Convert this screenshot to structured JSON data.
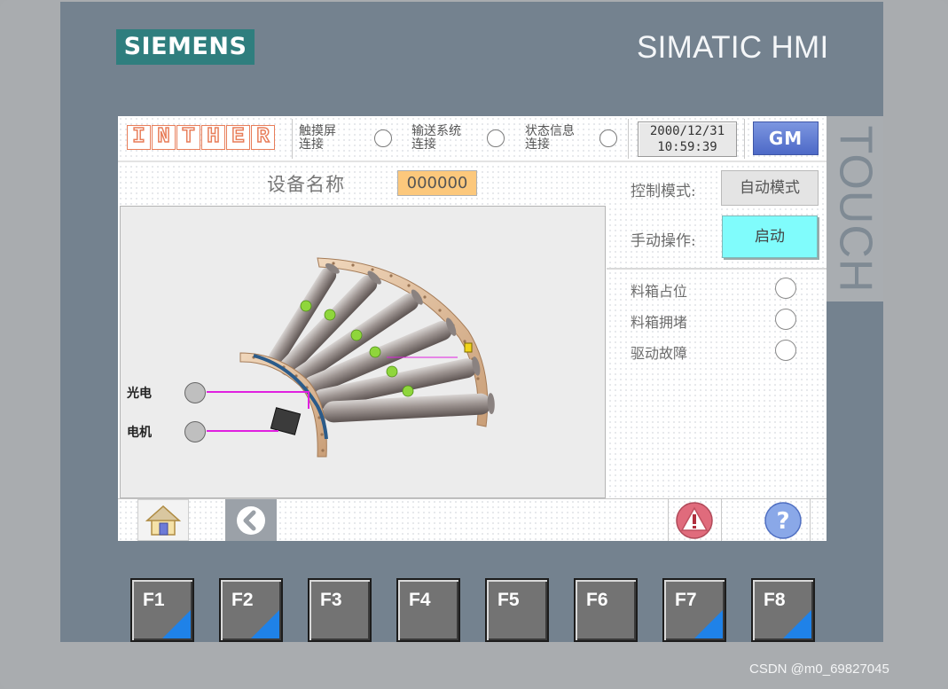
{
  "bezel": {
    "brand": "SIEMENS",
    "product": "SIMATIC HMI",
    "side_label": "TOUCH"
  },
  "header": {
    "logo_letters": [
      "I",
      "N",
      "T",
      "H",
      "E",
      "R"
    ],
    "connections": [
      {
        "line1": "触摸屏",
        "line2": "连接"
      },
      {
        "line1": "输送系统",
        "line2": "连接"
      },
      {
        "line1": "状态信息",
        "line2": "连接"
      }
    ],
    "date": "2000/12/31",
    "time": "10:59:39",
    "gm_label": "GM"
  },
  "device": {
    "name_label": "设备名称",
    "name_value": "000000"
  },
  "control": {
    "mode_label": "控制模式:",
    "mode_value": "自动模式",
    "manual_label": "手动操作:",
    "start_label": "启动"
  },
  "status_items": [
    {
      "label": "料箱占位"
    },
    {
      "label": "料箱拥堵"
    },
    {
      "label": "驱动故障"
    }
  ],
  "signals": {
    "photo_label": "光电",
    "motor_label": "电机"
  },
  "footer": {
    "icons": [
      "home-icon",
      "back-icon",
      "alarm-icon",
      "help-icon"
    ]
  },
  "fkeys": [
    "F1",
    "F2",
    "F3",
    "F4",
    "F5",
    "F6",
    "F7",
    "F8"
  ],
  "watermark": "CSDN @m0_69827045",
  "colors": {
    "bezel": "#74828f",
    "siemens_teal": "#2f7e7e",
    "device_value_bg": "#fcc87c",
    "start_button": "#80fcfc",
    "fkey_triangle": "#1f82e8",
    "signal_wire": "#e020e0"
  }
}
